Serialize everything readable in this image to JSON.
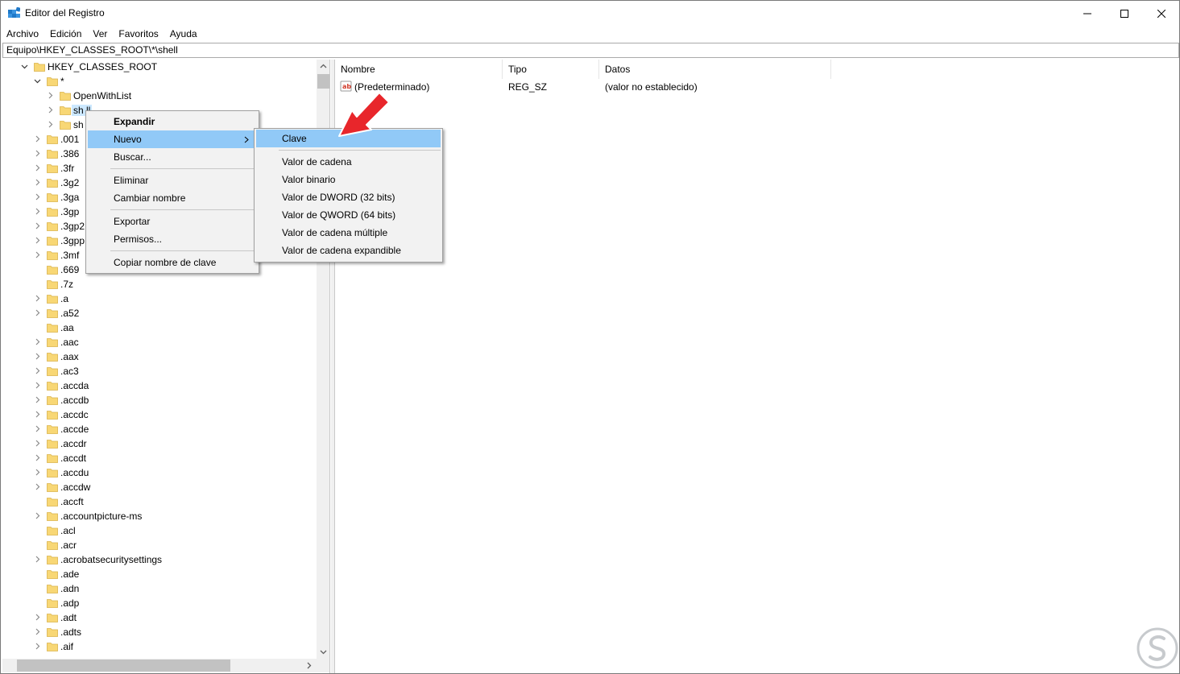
{
  "window": {
    "title": "Editor del Registro",
    "minimize_icon": "minimize-icon",
    "maximize_icon": "maximize-icon",
    "close_icon": "close-icon"
  },
  "menubar": [
    "Archivo",
    "Edición",
    "Ver",
    "Favoritos",
    "Ayuda"
  ],
  "address": "Equipo\\HKEY_CLASSES_ROOT\\*\\shell",
  "tree": {
    "root": "HKEY_CLASSES_ROOT",
    "star": "*",
    "star_children": [
      "OpenWithList",
      "sh  ll",
      "sh"
    ],
    "items": [
      ".001",
      ".386",
      ".3fr",
      ".3g2",
      ".3ga",
      ".3gp",
      ".3gp2",
      ".3gpp",
      ".3mf",
      ".669",
      ".7z",
      ".a",
      ".a52",
      ".aa",
      ".aac",
      ".aax",
      ".ac3",
      ".accda",
      ".accdb",
      ".accdc",
      ".accde",
      ".accdr",
      ".accdt",
      ".accdu",
      ".accdw",
      ".accft",
      ".accountpicture-ms",
      ".acl",
      ".acr",
      ".acrobatsecuritysettings",
      ".ade",
      ".adn",
      ".adp",
      ".adt",
      ".adts",
      ".aif"
    ]
  },
  "list": {
    "headers": [
      "Nombre",
      "Tipo",
      "Datos"
    ],
    "rows": [
      {
        "name": "(Predeterminado)",
        "type": "REG_SZ",
        "data": "(valor no establecido)"
      }
    ]
  },
  "context_menu": {
    "items": [
      "Expandir",
      "Nuevo",
      "Buscar...",
      "Eliminar",
      "Cambiar nombre",
      "Exportar",
      "Permisos...",
      "Copiar nombre de clave"
    ]
  },
  "submenu": {
    "items": [
      "Clave",
      "Valor de cadena",
      "Valor binario",
      "Valor de DWORD (32 bits)",
      "Valor de QWORD (64 bits)",
      "Valor de cadena múltiple",
      "Valor de cadena expandible"
    ]
  },
  "colors": {
    "highlight": "#91c9f7",
    "selected": "#cce8ff",
    "folder": "#f8d775",
    "arrow": "#e8262b"
  }
}
